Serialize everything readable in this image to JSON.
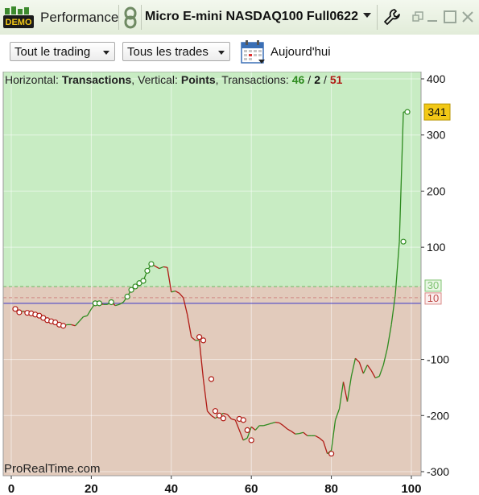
{
  "titlebar": {
    "demo_badge": "DEMO",
    "title": "Performance",
    "instrument": "Micro E-mini NASDAQ100 Full0622"
  },
  "toolbar": {
    "trading_filter": "Tout le trading",
    "trades_filter": "Tous les trades",
    "date_label": "Aujourd'hui"
  },
  "header": {
    "horizontal_label": "Horizontal:",
    "horizontal_value": "Transactions",
    "vertical_label": ", Vertical:",
    "vertical_value": "Points",
    "transactions_label": ", Transactions:",
    "wins": "46",
    "sep1": "/",
    "breakeven": "2",
    "sep2": "/",
    "losses": "51"
  },
  "watermark": "ProRealTime.com",
  "colors": {
    "gain_zone": "#c8ecc3",
    "loss_zone": "#e2cbbc",
    "up_line": "#2e8b1f",
    "down_line": "#b01a14",
    "zero_line": "#3a38c8",
    "current_badge": "#f2c816"
  },
  "chart_data": {
    "type": "line",
    "xlim": [
      0,
      100
    ],
    "ylim": [
      -310,
      400
    ],
    "x_ticks": [
      "0",
      "20",
      "40",
      "60",
      "80",
      "100"
    ],
    "y_ticks": [
      "400",
      "300",
      "200",
      "100",
      "-100",
      "-200",
      "-300"
    ],
    "current_value": "341",
    "gain_threshold": "30",
    "loss_threshold": "10",
    "series": [
      {
        "x": [
          1,
          2,
          3,
          4,
          5,
          6,
          7,
          8,
          9,
          10,
          11,
          12,
          13,
          14,
          15,
          16,
          17,
          18,
          19,
          20,
          21,
          22,
          23,
          24,
          25,
          26,
          27,
          28,
          29,
          30,
          31,
          32,
          33,
          34,
          35,
          36,
          37,
          38,
          39,
          40,
          41,
          42,
          43,
          44,
          45,
          46,
          47,
          48,
          49,
          50,
          51,
          52,
          53,
          54,
          55,
          56,
          57,
          58,
          59,
          60,
          61,
          62,
          63,
          64,
          65,
          66,
          67,
          68,
          69,
          70,
          71,
          72,
          73,
          74,
          75,
          76,
          77,
          78,
          79,
          80,
          81,
          82,
          83,
          84,
          85,
          86,
          87,
          88,
          89,
          90,
          91,
          92,
          93,
          94,
          95,
          96,
          97,
          98,
          99
        ],
        "y": [
          -10,
          -16,
          -14,
          -17,
          -18,
          -20,
          -22,
          -26,
          -30,
          -32,
          -34,
          -38,
          -40,
          -38,
          -38,
          -40,
          -32,
          -24,
          -22,
          -10,
          0,
          0,
          -2,
          -2,
          2,
          -4,
          -2,
          2,
          12,
          24,
          30,
          36,
          40,
          58,
          70,
          66,
          62,
          65,
          64,
          20,
          22,
          18,
          10,
          -20,
          -60,
          -66,
          -66,
          -135,
          -192,
          -200,
          -205,
          -200,
          -196,
          -198,
          -206,
          -208,
          -226,
          -244,
          -240,
          -220,
          -226,
          -218,
          -218,
          -216,
          -214,
          -212,
          -213,
          -218,
          -224,
          -228,
          -233,
          -232,
          -230,
          -236,
          -236,
          -236,
          -240,
          -246,
          -268,
          -262,
          -208,
          -188,
          -140,
          -175,
          -130,
          -98,
          -105,
          -125,
          -110,
          -120,
          -133,
          -130,
          -110,
          -80,
          -38,
          16,
          110,
          341,
          341
        ]
      }
    ],
    "markers": [
      {
        "x": 1,
        "y": -10
      },
      {
        "x": 2,
        "y": -16
      },
      {
        "x": 4,
        "y": -17
      },
      {
        "x": 5,
        "y": -18
      },
      {
        "x": 6,
        "y": -20
      },
      {
        "x": 7,
        "y": -22
      },
      {
        "x": 8,
        "y": -26
      },
      {
        "x": 9,
        "y": -30
      },
      {
        "x": 10,
        "y": -32
      },
      {
        "x": 11,
        "y": -34
      },
      {
        "x": 12,
        "y": -38
      },
      {
        "x": 13,
        "y": -40
      },
      {
        "x": 21,
        "y": 0
      },
      {
        "x": 22,
        "y": 0
      },
      {
        "x": 25,
        "y": 2
      },
      {
        "x": 29,
        "y": 12
      },
      {
        "x": 30,
        "y": 24
      },
      {
        "x": 31,
        "y": 30
      },
      {
        "x": 32,
        "y": 36
      },
      {
        "x": 33,
        "y": 40
      },
      {
        "x": 34,
        "y": 58
      },
      {
        "x": 35,
        "y": 70
      },
      {
        "x": 47,
        "y": -60
      },
      {
        "x": 48,
        "y": -66
      },
      {
        "x": 50,
        "y": -135
      },
      {
        "x": 51,
        "y": -192
      },
      {
        "x": 52,
        "y": -200
      },
      {
        "x": 53,
        "y": -205
      },
      {
        "x": 57,
        "y": -206
      },
      {
        "x": 58,
        "y": -208
      },
      {
        "x": 59,
        "y": -226
      },
      {
        "x": 60,
        "y": -244
      },
      {
        "x": 80,
        "y": -268
      },
      {
        "x": 98,
        "y": 110
      },
      {
        "x": 99,
        "y": 341
      }
    ]
  }
}
